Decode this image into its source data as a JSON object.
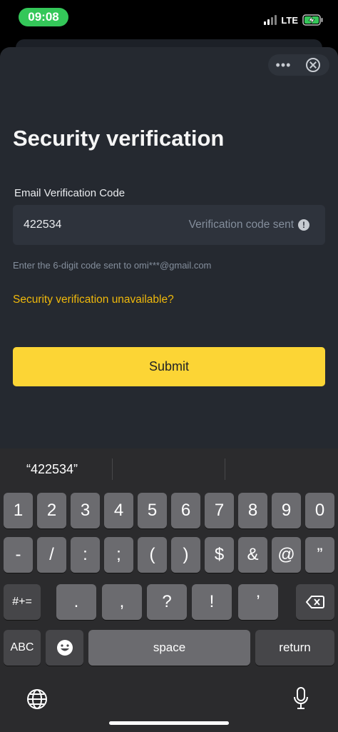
{
  "status": {
    "time": "09:08",
    "network": "LTE"
  },
  "sheet": {
    "title": "Security verification",
    "field_label": "Email Verification Code",
    "code_value": "422534",
    "code_status": "Verification code sent",
    "hint": "Enter the 6-digit code sent to omi***@gmail.com",
    "unavailable_link": "Security verification unavailable?",
    "submit_label": "Submit",
    "accent": "#fcd535",
    "link_color": "#f0b90b"
  },
  "keyboard": {
    "suggestion": "“422534”",
    "row1": [
      "1",
      "2",
      "3",
      "4",
      "5",
      "6",
      "7",
      "8",
      "9",
      "0"
    ],
    "row2": [
      "-",
      "/",
      ":",
      ";",
      "(",
      ")",
      "$",
      "&",
      "@",
      "”"
    ],
    "row3": [
      "#+=",
      ".",
      ",",
      "?",
      "!",
      "’"
    ],
    "abc": "ABC",
    "space": "space",
    "return": "return"
  }
}
